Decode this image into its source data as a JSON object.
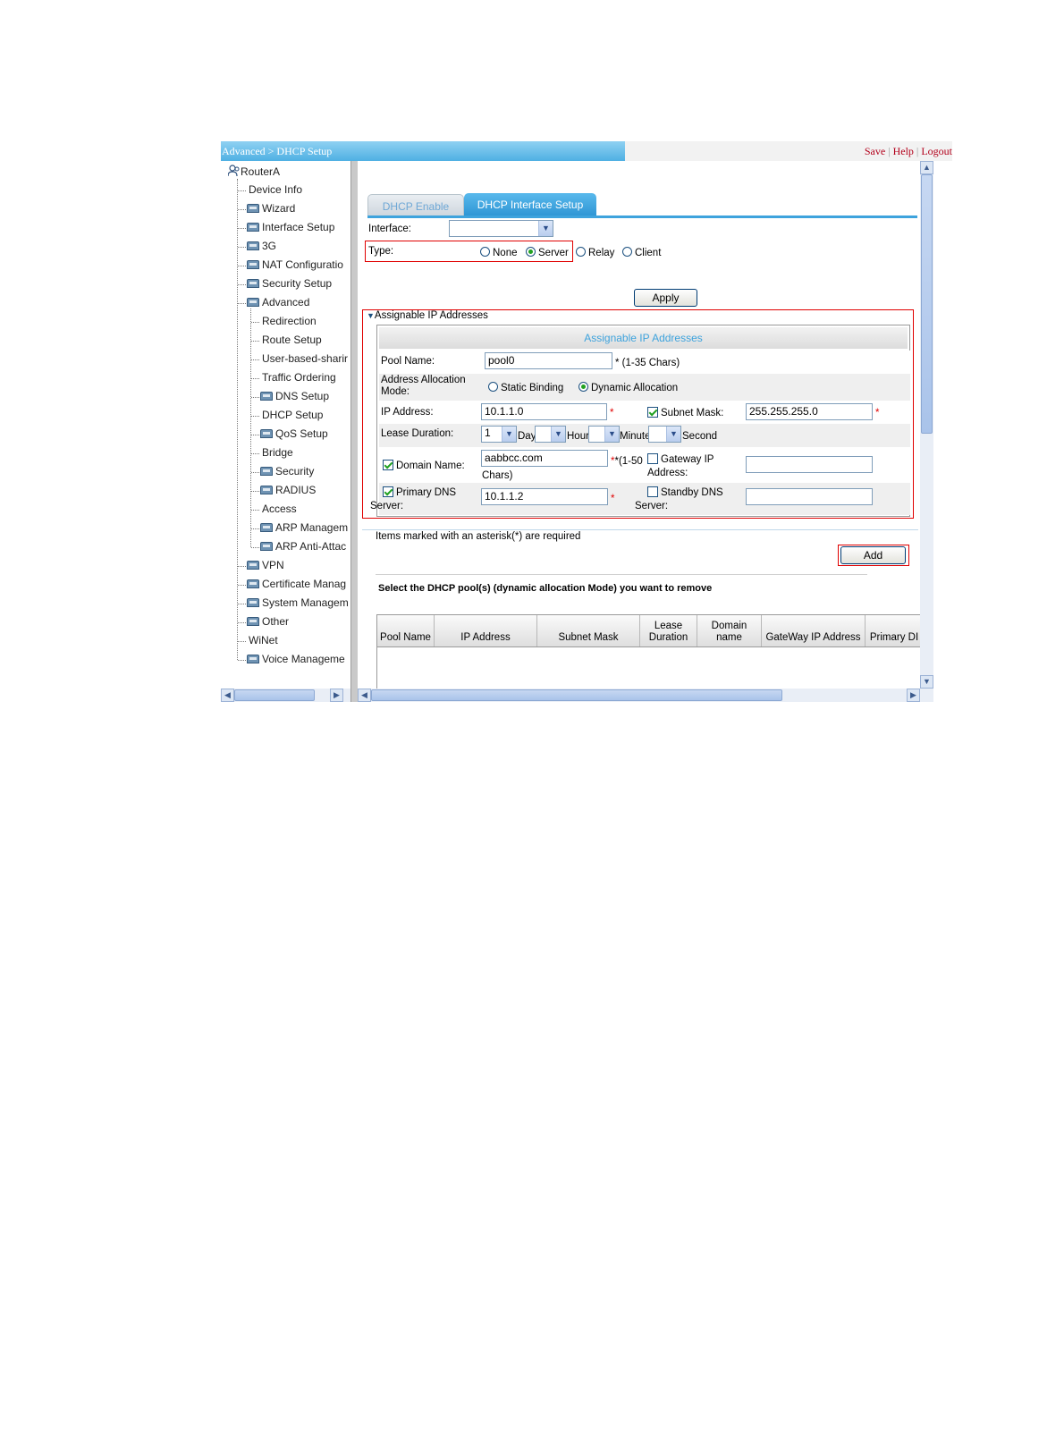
{
  "header": {
    "breadcrumb": "Advanced > DHCP Setup",
    "links": [
      "Save",
      "Help",
      "Logout"
    ]
  },
  "nav": {
    "root": "RouterA",
    "items": [
      {
        "label": "Device Info",
        "level": 1,
        "folder": false
      },
      {
        "label": "Wizard",
        "level": 1,
        "folder": true
      },
      {
        "label": "Interface Setup",
        "level": 1,
        "folder": true
      },
      {
        "label": "3G",
        "level": 1,
        "folder": true
      },
      {
        "label": "NAT Configuratio",
        "level": 1,
        "folder": true
      },
      {
        "label": "Security Setup",
        "level": 1,
        "folder": true
      },
      {
        "label": "Advanced",
        "level": 1,
        "folder": true
      },
      {
        "label": "Redirection",
        "level": 2,
        "folder": false
      },
      {
        "label": "Route Setup",
        "level": 2,
        "folder": false
      },
      {
        "label": "User-based-sharir",
        "level": 2,
        "folder": false
      },
      {
        "label": "Traffic Ordering",
        "level": 2,
        "folder": false
      },
      {
        "label": "DNS Setup",
        "level": 2,
        "folder": true
      },
      {
        "label": "DHCP Setup",
        "level": 2,
        "folder": false
      },
      {
        "label": "QoS Setup",
        "level": 2,
        "folder": true
      },
      {
        "label": "Bridge",
        "level": 2,
        "folder": false
      },
      {
        "label": "Security",
        "level": 2,
        "folder": true
      },
      {
        "label": "RADIUS",
        "level": 2,
        "folder": true
      },
      {
        "label": "Access",
        "level": 2,
        "folder": false
      },
      {
        "label": "ARP Managem",
        "level": 2,
        "folder": true
      },
      {
        "label": "ARP Anti-Attac",
        "level": 2,
        "folder": true
      },
      {
        "label": "VPN",
        "level": 1,
        "folder": true
      },
      {
        "label": "Certificate Manag",
        "level": 1,
        "folder": true
      },
      {
        "label": "System Managem",
        "level": 1,
        "folder": true
      },
      {
        "label": "Other",
        "level": 1,
        "folder": true
      },
      {
        "label": "WiNet",
        "level": 1,
        "folder": false
      },
      {
        "label": "Voice Manageme",
        "level": 1,
        "folder": true
      }
    ]
  },
  "tabs": [
    {
      "label": "DHCP Enable",
      "active": false
    },
    {
      "label": "DHCP Interface Setup",
      "active": true
    }
  ],
  "form": {
    "interface_label": "Interface:",
    "interface_value": "",
    "type_label": "Type:",
    "type_options": [
      "None",
      "Server",
      "Relay",
      "Client"
    ],
    "type_selected": "Server",
    "apply_label": "Apply"
  },
  "pool": {
    "section_label": "Assignable IP Addresses",
    "table_title": "Assignable IP Addresses",
    "pool_name_label": "Pool Name:",
    "pool_name_value": "pool0",
    "pool_name_hint": "* (1-35 Chars)",
    "alloc_label_1": "Address Allocation",
    "alloc_label_2": "Mode:",
    "alloc_options": [
      "Static Binding",
      "Dynamic Allocation"
    ],
    "alloc_selected": "Dynamic Allocation",
    "ip_label": "IP Address:",
    "ip_value": "10.1.1.0",
    "subnet_label": "Subnet Mask:",
    "subnet_value": "255.255.255.0",
    "subnet_checked": true,
    "lease_label": "Lease Duration:",
    "lease_day": "1",
    "lease_units": [
      "Day",
      "Hour",
      "Minute",
      "Second"
    ],
    "domain_label": "Domain Name:",
    "domain_checked": true,
    "domain_value": "aabbcc.com",
    "domain_hint_1": "*(1-50",
    "domain_hint_2": "Chars)",
    "gateway_label_1": "Gateway IP",
    "gateway_label_2": "Address:",
    "gateway_checked": false,
    "gateway_value": "",
    "dns_label_1": "Primary DNS",
    "dns_label_2": "Server:",
    "dns_checked": true,
    "dns_value": "10.1.1.2",
    "standby_label_1": "Standby DNS",
    "standby_label_2": "Server:",
    "standby_checked": false,
    "standby_value": "",
    "required_note": "Items marked with an asterisk(*) are required",
    "add_label": "Add"
  },
  "remove": {
    "title": "Select the DHCP pool(s) (dynamic allocation Mode) you want to remove",
    "columns": [
      "Pool Name",
      "IP Address",
      "Subnet Mask",
      "Lease Duration",
      "Domain name",
      "GateWay IP Address",
      "Primary DI"
    ]
  },
  "colors": {
    "accent": "#3ea3dd",
    "header_link": "#b3001b",
    "highlight": "#e00000",
    "check": "#21a121"
  }
}
